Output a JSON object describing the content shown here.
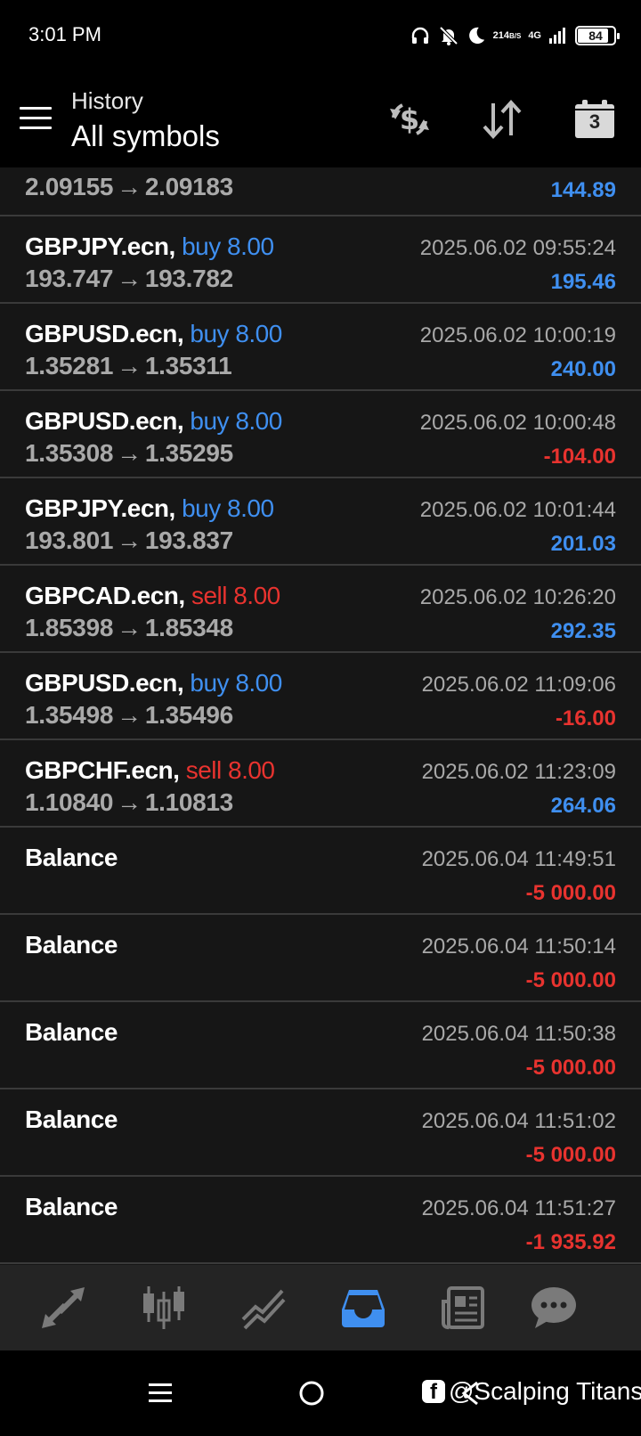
{
  "status_bar": {
    "time": "3:01 PM",
    "net_speed_value": "214",
    "net_speed_unit": "B/S",
    "network_type": "4G",
    "battery_level": "84",
    "battery_fraction": 0.84
  },
  "header": {
    "subtitle": "History",
    "title": "All symbols",
    "calendar_day": "3"
  },
  "history": {
    "partial_row": {
      "price_open": "2.09155",
      "price_close": "2.09183",
      "profit": "144.89",
      "profit_sign": "pos"
    },
    "rows": [
      {
        "symbol": "GBPJPY.ecn,",
        "side": "buy 8.00",
        "side_type": "buy",
        "price_open": "193.747",
        "price_close": "193.782",
        "time": "2025.06.02 09:55:24",
        "profit": "195.46",
        "profit_sign": "pos"
      },
      {
        "symbol": "GBPUSD.ecn,",
        "side": "buy 8.00",
        "side_type": "buy",
        "price_open": "1.35281",
        "price_close": "1.35311",
        "time": "2025.06.02 10:00:19",
        "profit": "240.00",
        "profit_sign": "pos"
      },
      {
        "symbol": "GBPUSD.ecn,",
        "side": "buy 8.00",
        "side_type": "buy",
        "price_open": "1.35308",
        "price_close": "1.35295",
        "time": "2025.06.02 10:00:48",
        "profit": "-104.00",
        "profit_sign": "neg"
      },
      {
        "symbol": "GBPJPY.ecn,",
        "side": "buy 8.00",
        "side_type": "buy",
        "price_open": "193.801",
        "price_close": "193.837",
        "time": "2025.06.02 10:01:44",
        "profit": "201.03",
        "profit_sign": "pos"
      },
      {
        "symbol": "GBPCAD.ecn,",
        "side": "sell 8.00",
        "side_type": "sell",
        "price_open": "1.85398",
        "price_close": "1.85348",
        "time": "2025.06.02 10:26:20",
        "profit": "292.35",
        "profit_sign": "pos"
      },
      {
        "symbol": "GBPUSD.ecn,",
        "side": "buy 8.00",
        "side_type": "buy",
        "price_open": "1.35498",
        "price_close": "1.35496",
        "time": "2025.06.02 11:09:06",
        "profit": "-16.00",
        "profit_sign": "neg"
      },
      {
        "symbol": "GBPCHF.ecn,",
        "side": "sell 8.00",
        "side_type": "sell",
        "price_open": "1.10840",
        "price_close": "1.10813",
        "time": "2025.06.02 11:23:09",
        "profit": "264.06",
        "profit_sign": "pos"
      },
      {
        "symbol": "Balance",
        "side": "",
        "side_type": "",
        "price_open": "",
        "price_close": "",
        "time": "2025.06.04 11:49:51",
        "profit": "-5 000.00",
        "profit_sign": "neg"
      },
      {
        "symbol": "Balance",
        "side": "",
        "side_type": "",
        "price_open": "",
        "price_close": "",
        "time": "2025.06.04 11:50:14",
        "profit": "-5 000.00",
        "profit_sign": "neg"
      },
      {
        "symbol": "Balance",
        "side": "",
        "side_type": "",
        "price_open": "",
        "price_close": "",
        "time": "2025.06.04 11:50:38",
        "profit": "-5 000.00",
        "profit_sign": "neg"
      },
      {
        "symbol": "Balance",
        "side": "",
        "side_type": "",
        "price_open": "",
        "price_close": "",
        "time": "2025.06.04 11:51:02",
        "profit": "-5 000.00",
        "profit_sign": "neg"
      },
      {
        "symbol": "Balance",
        "side": "",
        "side_type": "",
        "price_open": "",
        "price_close": "",
        "time": "2025.06.04 11:51:27",
        "profit": "-1 935.92",
        "profit_sign": "neg"
      }
    ],
    "arrow_glyph": "→"
  },
  "bottom_nav": {
    "items": [
      {
        "name": "quotes",
        "icon": "arrows-diagonal-icon",
        "active": false
      },
      {
        "name": "chart",
        "icon": "candlestick-icon",
        "active": false
      },
      {
        "name": "trade",
        "icon": "trend-lines-icon",
        "active": false
      },
      {
        "name": "history",
        "icon": "inbox-icon",
        "active": true
      },
      {
        "name": "news",
        "icon": "newspaper-icon",
        "active": false
      },
      {
        "name": "messages",
        "icon": "chat-bubble-icon",
        "active": false
      }
    ],
    "active_color": "#3f8ff0",
    "inactive_color": "#7a7a7a"
  },
  "watermark": {
    "fb_glyph": "f",
    "text": "@Scalping Titans"
  },
  "colors": {
    "buy": "#3f8ff0",
    "sell": "#e8332f",
    "background": "#161616",
    "divider": "#3a3a3a"
  }
}
